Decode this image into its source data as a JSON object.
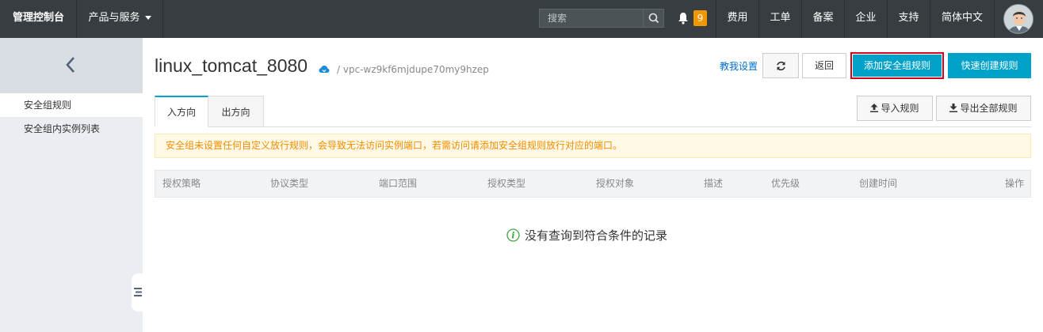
{
  "topbar": {
    "console": "管理控制台",
    "products": "产品与服务",
    "search_placeholder": "搜索",
    "notification_count": "9",
    "nav": [
      "费用",
      "工单",
      "备案",
      "企业",
      "支持",
      "简体中文"
    ]
  },
  "sidebar": {
    "items": [
      {
        "label": "安全组规则",
        "active": true
      },
      {
        "label": "安全组内实例列表",
        "active": false
      }
    ]
  },
  "header": {
    "title": "linux_tomcat_8080",
    "vpc": "/ vpc-wz9kf6mjdupe70my9hzep",
    "help_link": "教我设置",
    "back_label": "返回",
    "add_rule_label": "添加安全组规则",
    "quick_create_label": "快速创建规则"
  },
  "tabs": {
    "inbound": "入方向",
    "outbound": "出方向",
    "import_label": "导入规则",
    "export_label": "导出全部规则"
  },
  "warning": "安全组未设置任何自定义放行规则，会导致无法访问实例端口，若需访问请添加安全组规则放行对应的端口。",
  "table": {
    "columns": [
      "授权策略",
      "协议类型",
      "端口范围",
      "授权类型",
      "授权对象",
      "描述",
      "优先级",
      "创建时间",
      "操作"
    ],
    "empty_text": "没有查询到符合条件的记录"
  },
  "colors": {
    "topbar": "#373d41",
    "accent": "#00a2ca",
    "badge": "#f39700",
    "warning_text": "#f28c00",
    "highlight_border": "#d0021b"
  }
}
